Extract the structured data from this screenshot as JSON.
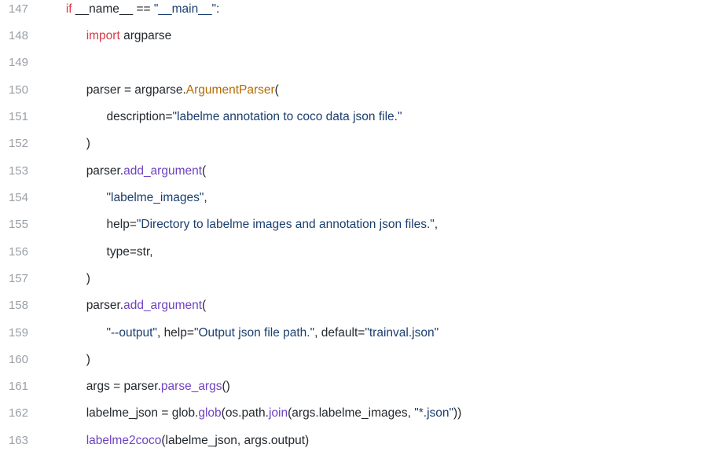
{
  "lines": [
    {
      "num": "147",
      "indent": 1,
      "tokens": [
        {
          "t": "keyword",
          "v": "if"
        },
        {
          "t": "plain",
          "v": " __name__ "
        },
        {
          "t": "op",
          "v": "=="
        },
        {
          "t": "plain",
          "v": " "
        },
        {
          "t": "string",
          "v": "\"__main__\""
        },
        {
          "t": "punct",
          "v": ":"
        }
      ]
    },
    {
      "num": "148",
      "indent": 2,
      "tokens": [
        {
          "t": "keyword",
          "v": "import"
        },
        {
          "t": "plain",
          "v": " argparse"
        }
      ]
    },
    {
      "num": "149",
      "indent": 0,
      "tokens": []
    },
    {
      "num": "150",
      "indent": 2,
      "tokens": [
        {
          "t": "plain",
          "v": "parser "
        },
        {
          "t": "op",
          "v": "="
        },
        {
          "t": "plain",
          "v": " argparse."
        },
        {
          "t": "class",
          "v": "ArgumentParser"
        },
        {
          "t": "punct",
          "v": "("
        }
      ]
    },
    {
      "num": "151",
      "indent": 3,
      "tokens": [
        {
          "t": "param",
          "v": "description"
        },
        {
          "t": "op",
          "v": "="
        },
        {
          "t": "string",
          "v": "\"labelme annotation to coco data json file.\""
        }
      ]
    },
    {
      "num": "152",
      "indent": 2,
      "tokens": [
        {
          "t": "punct",
          "v": ")"
        }
      ]
    },
    {
      "num": "153",
      "indent": 2,
      "tokens": [
        {
          "t": "plain",
          "v": "parser."
        },
        {
          "t": "func",
          "v": "add_argument"
        },
        {
          "t": "punct",
          "v": "("
        }
      ]
    },
    {
      "num": "154",
      "indent": 3,
      "tokens": [
        {
          "t": "string",
          "v": "\"labelme_images\""
        },
        {
          "t": "punct",
          "v": ","
        }
      ]
    },
    {
      "num": "155",
      "indent": 3,
      "tokens": [
        {
          "t": "param",
          "v": "help"
        },
        {
          "t": "op",
          "v": "="
        },
        {
          "t": "string",
          "v": "\"Directory to labelme images and annotation json files.\""
        },
        {
          "t": "punct",
          "v": ","
        }
      ]
    },
    {
      "num": "156",
      "indent": 3,
      "tokens": [
        {
          "t": "param",
          "v": "type"
        },
        {
          "t": "op",
          "v": "="
        },
        {
          "t": "plain",
          "v": "str,"
        }
      ]
    },
    {
      "num": "157",
      "indent": 2,
      "tokens": [
        {
          "t": "punct",
          "v": ")"
        }
      ]
    },
    {
      "num": "158",
      "indent": 2,
      "tokens": [
        {
          "t": "plain",
          "v": "parser."
        },
        {
          "t": "func",
          "v": "add_argument"
        },
        {
          "t": "punct",
          "v": "("
        }
      ]
    },
    {
      "num": "159",
      "indent": 3,
      "tokens": [
        {
          "t": "string",
          "v": "\"--output\""
        },
        {
          "t": "punct",
          "v": ", "
        },
        {
          "t": "param",
          "v": "help"
        },
        {
          "t": "op",
          "v": "="
        },
        {
          "t": "string",
          "v": "\"Output json file path.\""
        },
        {
          "t": "punct",
          "v": ", "
        },
        {
          "t": "param",
          "v": "default"
        },
        {
          "t": "op",
          "v": "="
        },
        {
          "t": "string",
          "v": "\"trainval.json\""
        }
      ]
    },
    {
      "num": "160",
      "indent": 2,
      "tokens": [
        {
          "t": "punct",
          "v": ")"
        }
      ]
    },
    {
      "num": "161",
      "indent": 2,
      "tokens": [
        {
          "t": "plain",
          "v": "args "
        },
        {
          "t": "op",
          "v": "="
        },
        {
          "t": "plain",
          "v": " parser."
        },
        {
          "t": "func",
          "v": "parse_args"
        },
        {
          "t": "punct",
          "v": "()"
        }
      ]
    },
    {
      "num": "162",
      "indent": 2,
      "tokens": [
        {
          "t": "plain",
          "v": "labelme_json "
        },
        {
          "t": "op",
          "v": "="
        },
        {
          "t": "plain",
          "v": " glob."
        },
        {
          "t": "func",
          "v": "glob"
        },
        {
          "t": "punct",
          "v": "("
        },
        {
          "t": "plain",
          "v": "os.path."
        },
        {
          "t": "func",
          "v": "join"
        },
        {
          "t": "punct",
          "v": "("
        },
        {
          "t": "plain",
          "v": "args.labelme_images, "
        },
        {
          "t": "string",
          "v": "\"*.json\""
        },
        {
          "t": "punct",
          "v": "))"
        }
      ]
    },
    {
      "num": "163",
      "indent": 2,
      "tokens": [
        {
          "t": "func",
          "v": "labelme2coco"
        },
        {
          "t": "punct",
          "v": "("
        },
        {
          "t": "plain",
          "v": "labelme_json, args.output"
        },
        {
          "t": "punct",
          "v": ")"
        }
      ]
    }
  ],
  "indent_unit": "      "
}
